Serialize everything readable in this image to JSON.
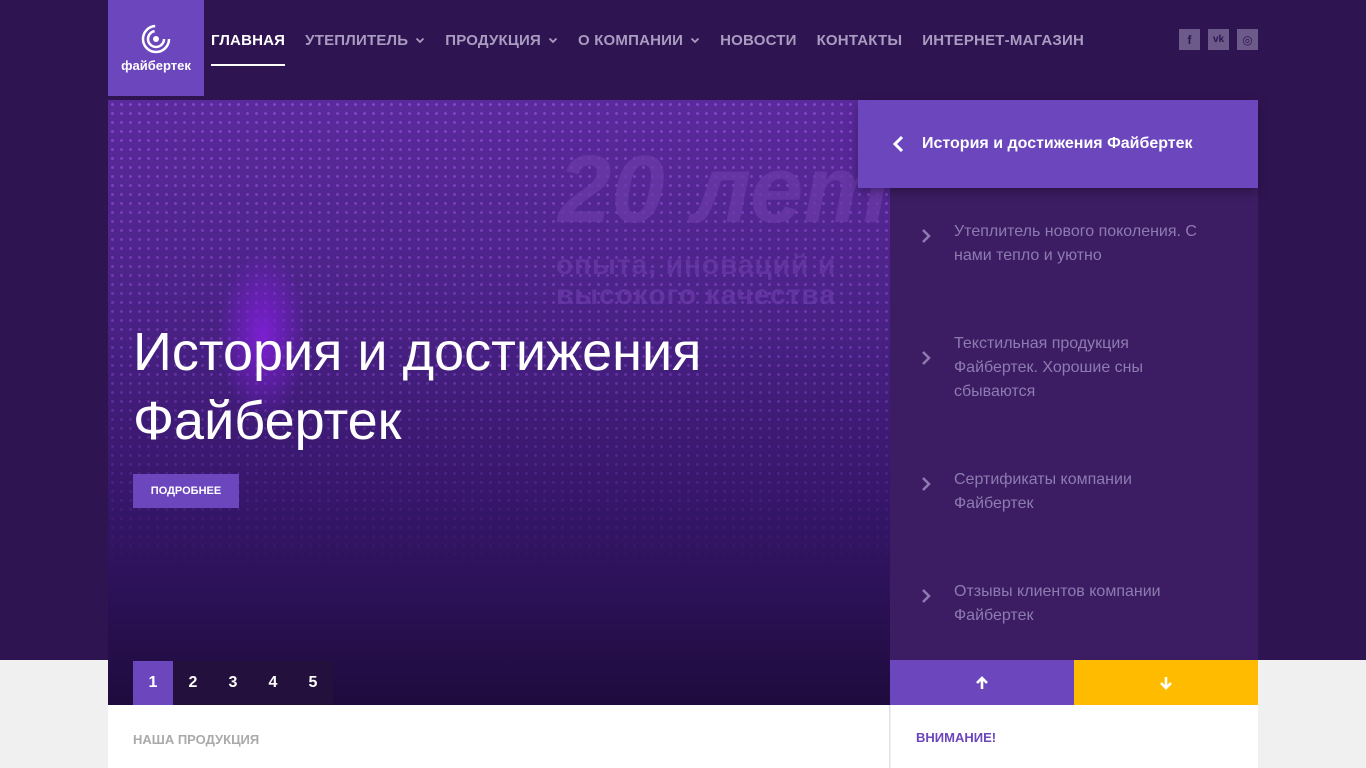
{
  "header": {
    "logo_text": "файбертек",
    "nav": [
      {
        "label": "ГЛАВНАЯ",
        "active": true,
        "dropdown": false
      },
      {
        "label": "УТЕПЛИТЕЛЬ",
        "active": false,
        "dropdown": true
      },
      {
        "label": "ПРОДУКЦИЯ",
        "active": false,
        "dropdown": true
      },
      {
        "label": "О КОМПАНИИ",
        "active": false,
        "dropdown": true
      },
      {
        "label": "НОВОСТИ",
        "active": false,
        "dropdown": false
      },
      {
        "label": "КОНТАКТЫ",
        "active": false,
        "dropdown": false
      },
      {
        "label": "ИНТЕРНЕТ-МАГАЗИН",
        "active": false,
        "dropdown": false
      }
    ],
    "social": [
      {
        "name": "facebook-icon",
        "glyph": "f"
      },
      {
        "name": "vk-icon",
        "glyph": "vk"
      },
      {
        "name": "instagram-icon",
        "glyph": "◎"
      }
    ]
  },
  "hero": {
    "watermark_big": "20 лет",
    "watermark_line1": "опыта, иноваций и",
    "watermark_line2": "высокого качества",
    "title_line1": "История и достижения",
    "title_line2": "Файбертек",
    "more_label": "ПОДРОБНЕЕ",
    "pages": [
      "1",
      "2",
      "3",
      "4",
      "5"
    ],
    "active_page": "1"
  },
  "slides": {
    "active": "История и достижения Файбертек",
    "items": [
      {
        "line1": "Утеплитель нового поколения. С",
        "line2": "нами тепло и уютно",
        "line3": ""
      },
      {
        "line1": "Текстильная продукция",
        "line2": "Файбертек. Хорошие сны",
        "line3": "сбываются"
      },
      {
        "line1": "Сертификаты компании",
        "line2": "Файбертек",
        "line3": ""
      },
      {
        "line1": "Отзывы клиентов компании",
        "line2": "Файбертек",
        "line3": ""
      }
    ]
  },
  "sections": {
    "products": "НАША ПРОДУКЦИЯ",
    "attention": "ВНИМАНИЕ!"
  },
  "colors": {
    "brand": "#6b46bd",
    "background_dark": "#2f1452",
    "accent_yellow": "#ffbb00"
  }
}
